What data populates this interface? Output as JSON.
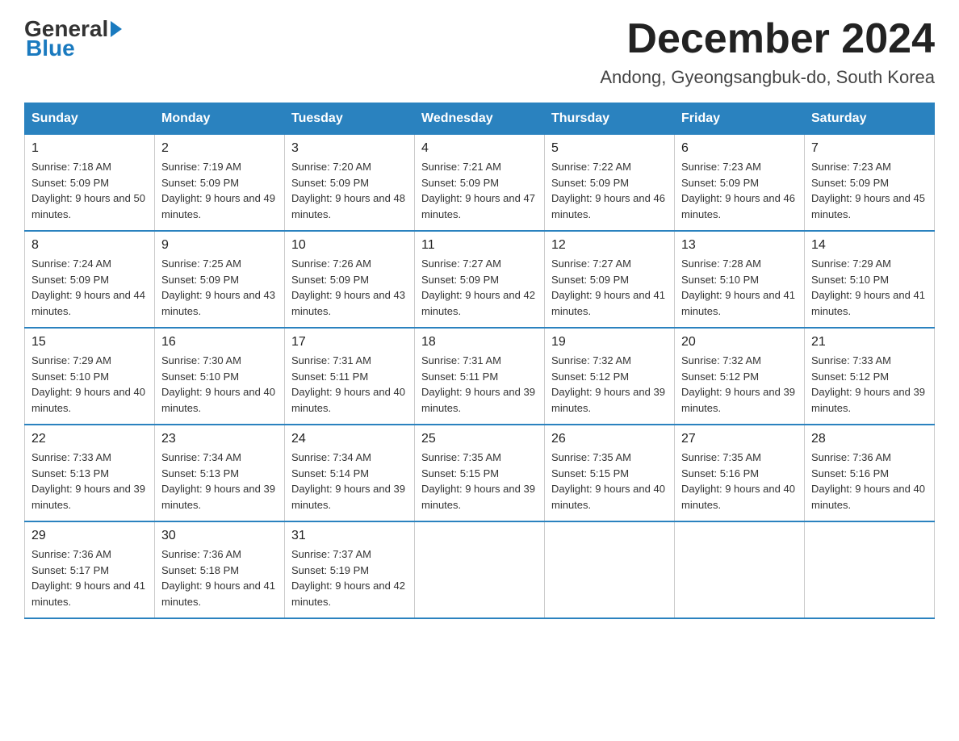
{
  "logo": {
    "general": "General",
    "blue": "Blue"
  },
  "header": {
    "month_year": "December 2024",
    "location": "Andong, Gyeongsangbuk-do, South Korea"
  },
  "days_of_week": [
    "Sunday",
    "Monday",
    "Tuesday",
    "Wednesday",
    "Thursday",
    "Friday",
    "Saturday"
  ],
  "weeks": [
    [
      {
        "day": "1",
        "sunrise": "Sunrise: 7:18 AM",
        "sunset": "Sunset: 5:09 PM",
        "daylight": "Daylight: 9 hours and 50 minutes."
      },
      {
        "day": "2",
        "sunrise": "Sunrise: 7:19 AM",
        "sunset": "Sunset: 5:09 PM",
        "daylight": "Daylight: 9 hours and 49 minutes."
      },
      {
        "day": "3",
        "sunrise": "Sunrise: 7:20 AM",
        "sunset": "Sunset: 5:09 PM",
        "daylight": "Daylight: 9 hours and 48 minutes."
      },
      {
        "day": "4",
        "sunrise": "Sunrise: 7:21 AM",
        "sunset": "Sunset: 5:09 PM",
        "daylight": "Daylight: 9 hours and 47 minutes."
      },
      {
        "day": "5",
        "sunrise": "Sunrise: 7:22 AM",
        "sunset": "Sunset: 5:09 PM",
        "daylight": "Daylight: 9 hours and 46 minutes."
      },
      {
        "day": "6",
        "sunrise": "Sunrise: 7:23 AM",
        "sunset": "Sunset: 5:09 PM",
        "daylight": "Daylight: 9 hours and 46 minutes."
      },
      {
        "day": "7",
        "sunrise": "Sunrise: 7:23 AM",
        "sunset": "Sunset: 5:09 PM",
        "daylight": "Daylight: 9 hours and 45 minutes."
      }
    ],
    [
      {
        "day": "8",
        "sunrise": "Sunrise: 7:24 AM",
        "sunset": "Sunset: 5:09 PM",
        "daylight": "Daylight: 9 hours and 44 minutes."
      },
      {
        "day": "9",
        "sunrise": "Sunrise: 7:25 AM",
        "sunset": "Sunset: 5:09 PM",
        "daylight": "Daylight: 9 hours and 43 minutes."
      },
      {
        "day": "10",
        "sunrise": "Sunrise: 7:26 AM",
        "sunset": "Sunset: 5:09 PM",
        "daylight": "Daylight: 9 hours and 43 minutes."
      },
      {
        "day": "11",
        "sunrise": "Sunrise: 7:27 AM",
        "sunset": "Sunset: 5:09 PM",
        "daylight": "Daylight: 9 hours and 42 minutes."
      },
      {
        "day": "12",
        "sunrise": "Sunrise: 7:27 AM",
        "sunset": "Sunset: 5:09 PM",
        "daylight": "Daylight: 9 hours and 41 minutes."
      },
      {
        "day": "13",
        "sunrise": "Sunrise: 7:28 AM",
        "sunset": "Sunset: 5:10 PM",
        "daylight": "Daylight: 9 hours and 41 minutes."
      },
      {
        "day": "14",
        "sunrise": "Sunrise: 7:29 AM",
        "sunset": "Sunset: 5:10 PM",
        "daylight": "Daylight: 9 hours and 41 minutes."
      }
    ],
    [
      {
        "day": "15",
        "sunrise": "Sunrise: 7:29 AM",
        "sunset": "Sunset: 5:10 PM",
        "daylight": "Daylight: 9 hours and 40 minutes."
      },
      {
        "day": "16",
        "sunrise": "Sunrise: 7:30 AM",
        "sunset": "Sunset: 5:10 PM",
        "daylight": "Daylight: 9 hours and 40 minutes."
      },
      {
        "day": "17",
        "sunrise": "Sunrise: 7:31 AM",
        "sunset": "Sunset: 5:11 PM",
        "daylight": "Daylight: 9 hours and 40 minutes."
      },
      {
        "day": "18",
        "sunrise": "Sunrise: 7:31 AM",
        "sunset": "Sunset: 5:11 PM",
        "daylight": "Daylight: 9 hours and 39 minutes."
      },
      {
        "day": "19",
        "sunrise": "Sunrise: 7:32 AM",
        "sunset": "Sunset: 5:12 PM",
        "daylight": "Daylight: 9 hours and 39 minutes."
      },
      {
        "day": "20",
        "sunrise": "Sunrise: 7:32 AM",
        "sunset": "Sunset: 5:12 PM",
        "daylight": "Daylight: 9 hours and 39 minutes."
      },
      {
        "day": "21",
        "sunrise": "Sunrise: 7:33 AM",
        "sunset": "Sunset: 5:12 PM",
        "daylight": "Daylight: 9 hours and 39 minutes."
      }
    ],
    [
      {
        "day": "22",
        "sunrise": "Sunrise: 7:33 AM",
        "sunset": "Sunset: 5:13 PM",
        "daylight": "Daylight: 9 hours and 39 minutes."
      },
      {
        "day": "23",
        "sunrise": "Sunrise: 7:34 AM",
        "sunset": "Sunset: 5:13 PM",
        "daylight": "Daylight: 9 hours and 39 minutes."
      },
      {
        "day": "24",
        "sunrise": "Sunrise: 7:34 AM",
        "sunset": "Sunset: 5:14 PM",
        "daylight": "Daylight: 9 hours and 39 minutes."
      },
      {
        "day": "25",
        "sunrise": "Sunrise: 7:35 AM",
        "sunset": "Sunset: 5:15 PM",
        "daylight": "Daylight: 9 hours and 39 minutes."
      },
      {
        "day": "26",
        "sunrise": "Sunrise: 7:35 AM",
        "sunset": "Sunset: 5:15 PM",
        "daylight": "Daylight: 9 hours and 40 minutes."
      },
      {
        "day": "27",
        "sunrise": "Sunrise: 7:35 AM",
        "sunset": "Sunset: 5:16 PM",
        "daylight": "Daylight: 9 hours and 40 minutes."
      },
      {
        "day": "28",
        "sunrise": "Sunrise: 7:36 AM",
        "sunset": "Sunset: 5:16 PM",
        "daylight": "Daylight: 9 hours and 40 minutes."
      }
    ],
    [
      {
        "day": "29",
        "sunrise": "Sunrise: 7:36 AM",
        "sunset": "Sunset: 5:17 PM",
        "daylight": "Daylight: 9 hours and 41 minutes."
      },
      {
        "day": "30",
        "sunrise": "Sunrise: 7:36 AM",
        "sunset": "Sunset: 5:18 PM",
        "daylight": "Daylight: 9 hours and 41 minutes."
      },
      {
        "day": "31",
        "sunrise": "Sunrise: 7:37 AM",
        "sunset": "Sunset: 5:19 PM",
        "daylight": "Daylight: 9 hours and 42 minutes."
      },
      null,
      null,
      null,
      null
    ]
  ]
}
